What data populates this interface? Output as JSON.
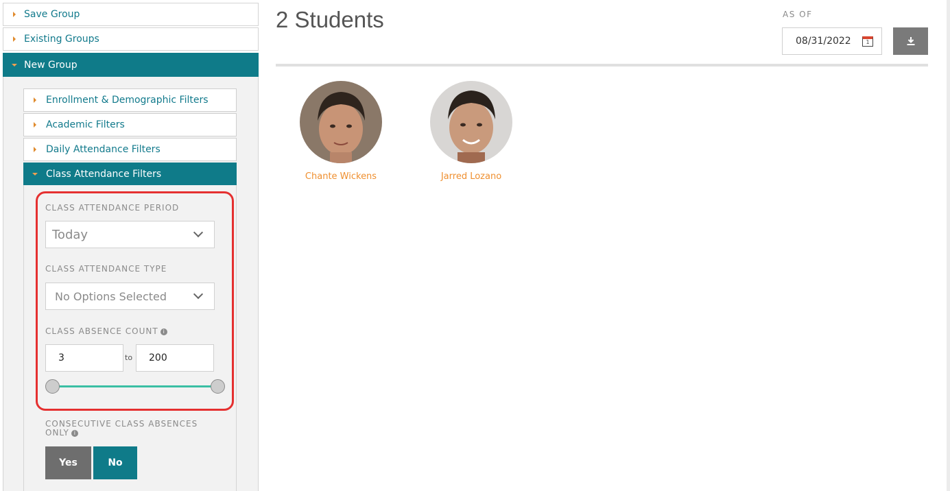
{
  "sidebar": {
    "sections": [
      {
        "label": "Save Group"
      },
      {
        "label": "Existing Groups"
      },
      {
        "label": "New Group"
      }
    ],
    "filters": [
      {
        "label": "Enrollment & Demographic Filters"
      },
      {
        "label": "Academic Filters"
      },
      {
        "label": "Daily Attendance Filters"
      },
      {
        "label": "Class Attendance Filters"
      }
    ],
    "class_attendance": {
      "period_label": "CLASS ATTENDANCE PERIOD",
      "period_value": "Today",
      "type_label": "CLASS ATTENDANCE TYPE",
      "type_value": "No Options Selected",
      "absence_label": "CLASS ABSENCE COUNT",
      "absence_min": "3",
      "absence_to": "to",
      "absence_max": "200",
      "consecutive_label_1": "CONSECUTIVE CLASS ABSENCES",
      "consecutive_label_2": "ONLY",
      "yes_label": "Yes",
      "no_label": "No"
    }
  },
  "main": {
    "title": "2 Students",
    "as_of_label": "AS OF",
    "as_of_date": "08/31/2022",
    "calendar_day": "1",
    "students": [
      {
        "name": "Chante Wickens"
      },
      {
        "name": "Jarred Lozano"
      }
    ]
  },
  "colors": {
    "teal": "#0f7b89",
    "orange": "#ef8f2f",
    "slider": "#3bbfa4",
    "highlight": "#e53030",
    "yes_bg": "#6e6e6e"
  }
}
